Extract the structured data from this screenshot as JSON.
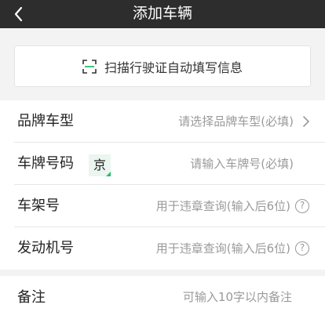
{
  "header": {
    "title": "添加车辆"
  },
  "scan": {
    "label": "扫描行驶证自动填写信息"
  },
  "form": {
    "brand": {
      "label": "品牌车型",
      "placeholder": "请选择品牌车型(必填)"
    },
    "plate": {
      "label": "车牌号码",
      "prefix": "京",
      "placeholder": "请输入车牌号(必填)"
    },
    "vin": {
      "label": "车架号",
      "placeholder": "用于违章查询(输入后6位)",
      "help": "?"
    },
    "engine": {
      "label": "发动机号",
      "placeholder": "用于违章查询(输入后6位)",
      "help": "?"
    },
    "remark": {
      "label": "备注",
      "placeholder": "可输入10字以内备注"
    }
  },
  "colors": {
    "header_bg": "#2d2d2d",
    "accent": "#2bbd6a",
    "placeholder": "#9a9a9a"
  },
  "icons": {
    "back": "chevron-left-icon",
    "scan": "scan-icon",
    "chevron": "chevron-right-icon",
    "help": "question-circle-icon"
  }
}
